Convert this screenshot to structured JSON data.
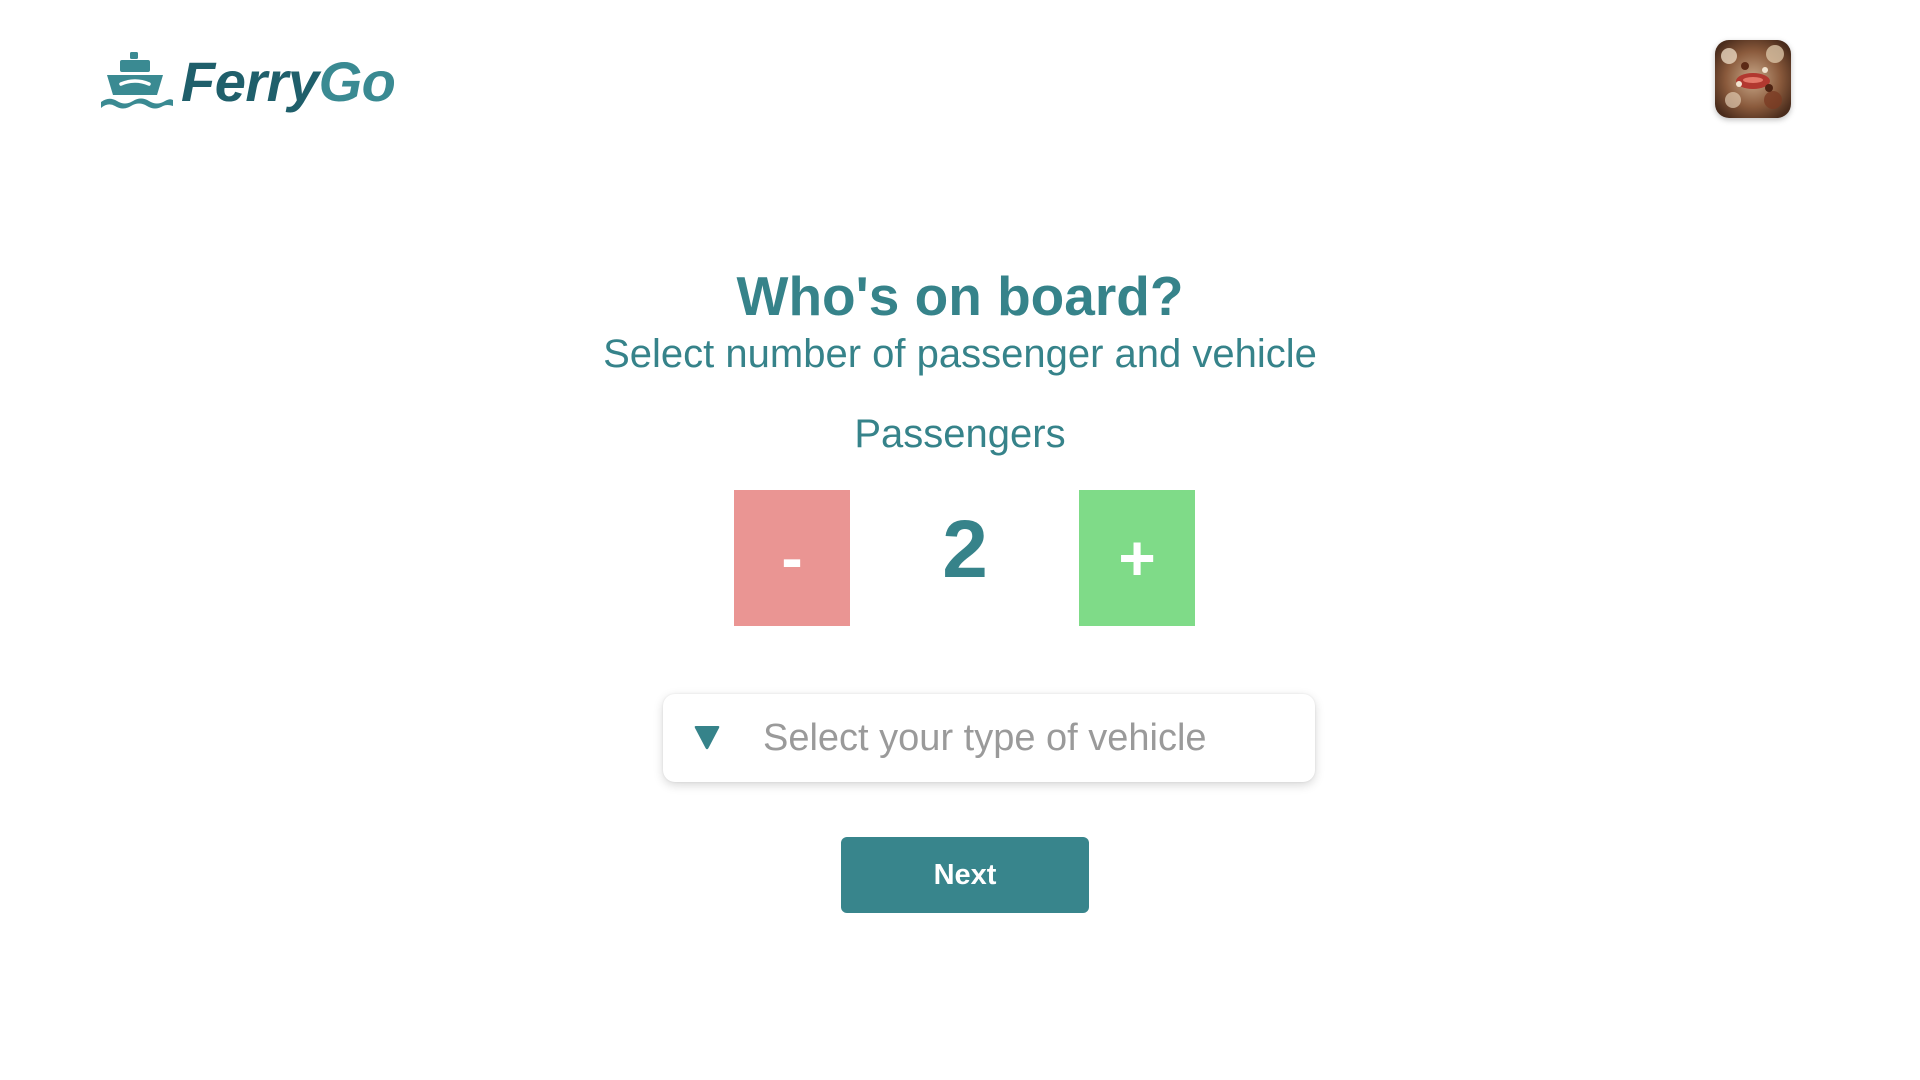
{
  "header": {
    "logo": {
      "part1": "Ferry",
      "part2": "Go"
    },
    "avatar": {
      "icon": "user-avatar-photo"
    }
  },
  "main": {
    "title": "Who's on board?",
    "subtitle": "Select number of passenger and vehicle",
    "passengers": {
      "label": "Passengers",
      "value": "2",
      "decrement_label": "-",
      "increment_label": "+"
    },
    "vehicle": {
      "placeholder": "Select your type of vehicle",
      "icon": "caret-down-icon"
    },
    "next_label": "Next"
  },
  "colors": {
    "primary": "#36838a",
    "logo_dark": "#1f5f6b",
    "decrement": "#ea9593",
    "increment": "#7fdb88",
    "placeholder": "#9a9a9a",
    "button": "#38858c"
  }
}
